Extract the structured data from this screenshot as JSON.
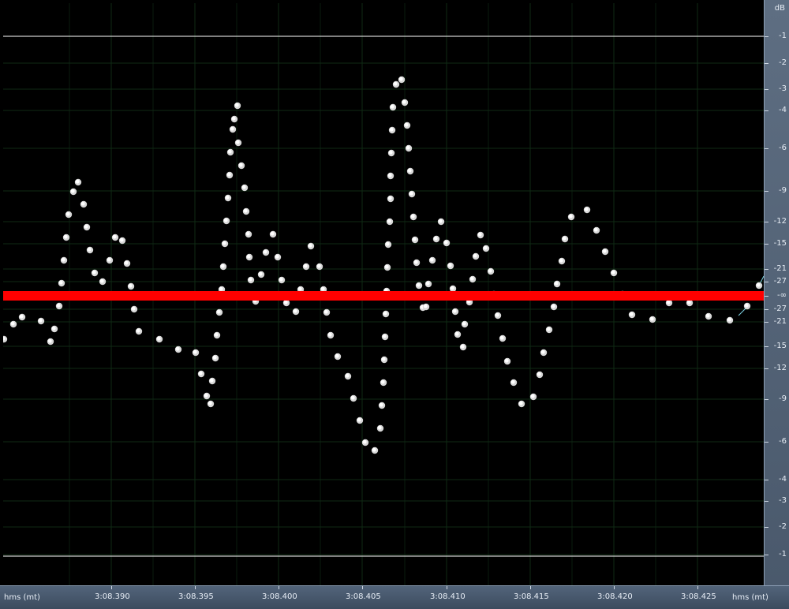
{
  "axes": {
    "db_unit": "dB",
    "time_unit_left": "hms (mt)",
    "time_unit_right": "hms (mt)",
    "db_ticks": [
      "-1",
      "-2",
      "-3",
      "-4",
      "-6",
      "-9",
      "-12",
      "-15",
      "-21",
      "-27",
      "-∞",
      "-27",
      "-21",
      "-15",
      "-12",
      "-9",
      "-6",
      "-4",
      "-3",
      "-2",
      "-1"
    ],
    "db_tick_pos": [
      46,
      80,
      113,
      140,
      188,
      242,
      281,
      309,
      341,
      357,
      375,
      392,
      408,
      439,
      467,
      506,
      560,
      608,
      635,
      668,
      703
    ],
    "time_ticks": [
      "3:08.390",
      "3:08.395",
      "3:08.400",
      "3:08.405",
      "3:08.410",
      "3:08.415",
      "3:08.420",
      "3:08.425"
    ],
    "time_tick_pos": [
      141,
      247,
      353,
      459,
      566,
      672,
      778,
      884
    ]
  },
  "colors": {
    "background": "#000000",
    "sample_dots": "#ffffff",
    "center_line": "#ff0000",
    "clip_lines": "#ffffff",
    "grid": "#0f2a14",
    "axis_panel": "#55667b"
  },
  "chart_data": {
    "type": "scatter",
    "title": "",
    "xlabel": "hms (mt)",
    "ylabel": "dB",
    "samples": [
      [
        5,
        430
      ],
      [
        17,
        411
      ],
      [
        28,
        402
      ],
      [
        52,
        407
      ],
      [
        64,
        433
      ],
      [
        69,
        417
      ],
      [
        75,
        388
      ],
      [
        78,
        359
      ],
      [
        81,
        330
      ],
      [
        84,
        301
      ],
      [
        87,
        272
      ],
      [
        93,
        243
      ],
      [
        99,
        231
      ],
      [
        106,
        259
      ],
      [
        110,
        288
      ],
      [
        114,
        317
      ],
      [
        120,
        346
      ],
      [
        130,
        357
      ],
      [
        139,
        330
      ],
      [
        146,
        301
      ],
      [
        155,
        305
      ],
      [
        161,
        334
      ],
      [
        166,
        363
      ],
      [
        170,
        392
      ],
      [
        176,
        420
      ],
      [
        202,
        430
      ],
      [
        226,
        443
      ],
      [
        248,
        447
      ],
      [
        255,
        474
      ],
      [
        262,
        502
      ],
      [
        267,
        512
      ],
      [
        269,
        483
      ],
      [
        273,
        454
      ],
      [
        275,
        425
      ],
      [
        278,
        396
      ],
      [
        281,
        367
      ],
      [
        283,
        338
      ],
      [
        285,
        309
      ],
      [
        287,
        280
      ],
      [
        289,
        251
      ],
      [
        291,
        222
      ],
      [
        292,
        193
      ],
      [
        295,
        164
      ],
      [
        297,
        151
      ],
      [
        301,
        134
      ],
      [
        302,
        181
      ],
      [
        306,
        210
      ],
      [
        310,
        238
      ],
      [
        312,
        268
      ],
      [
        315,
        297
      ],
      [
        316,
        326
      ],
      [
        318,
        355
      ],
      [
        324,
        382
      ],
      [
        327,
        377
      ],
      [
        331,
        348
      ],
      [
        337,
        320
      ],
      [
        346,
        297
      ],
      [
        352,
        326
      ],
      [
        357,
        355
      ],
      [
        363,
        384
      ],
      [
        375,
        395
      ],
      [
        381,
        367
      ],
      [
        388,
        338
      ],
      [
        394,
        312
      ],
      [
        405,
        338
      ],
      [
        410,
        367
      ],
      [
        414,
        396
      ],
      [
        419,
        425
      ],
      [
        428,
        452
      ],
      [
        441,
        477
      ],
      [
        448,
        505
      ],
      [
        456,
        533
      ],
      [
        463,
        561
      ],
      [
        475,
        571
      ],
      [
        482,
        543
      ],
      [
        484,
        514
      ],
      [
        486,
        485
      ],
      [
        487,
        456
      ],
      [
        488,
        427
      ],
      [
        489,
        398
      ],
      [
        490,
        369
      ],
      [
        491,
        339
      ],
      [
        492,
        310
      ],
      [
        494,
        281
      ],
      [
        495,
        252
      ],
      [
        495,
        223
      ],
      [
        496,
        194
      ],
      [
        497,
        165
      ],
      [
        498,
        136
      ],
      [
        502,
        107
      ],
      [
        509,
        101
      ],
      [
        513,
        130
      ],
      [
        516,
        159
      ],
      [
        518,
        188
      ],
      [
        520,
        217
      ],
      [
        522,
        246
      ],
      [
        524,
        275
      ],
      [
        526,
        304
      ],
      [
        528,
        333
      ],
      [
        531,
        362
      ],
      [
        536,
        390
      ],
      [
        540,
        389
      ],
      [
        543,
        360
      ],
      [
        548,
        330
      ],
      [
        553,
        303
      ],
      [
        559,
        281
      ],
      [
        566,
        308
      ],
      [
        571,
        337
      ],
      [
        574,
        366
      ],
      [
        577,
        395
      ],
      [
        580,
        424
      ],
      [
        587,
        440
      ],
      [
        589,
        411
      ],
      [
        595,
        383
      ],
      [
        599,
        354
      ],
      [
        603,
        325
      ],
      [
        609,
        298
      ],
      [
        616,
        315
      ],
      [
        622,
        344
      ],
      [
        626,
        373
      ],
      [
        631,
        400
      ],
      [
        637,
        429
      ],
      [
        643,
        458
      ],
      [
        651,
        485
      ],
      [
        661,
        512
      ],
      [
        676,
        503
      ],
      [
        684,
        475
      ],
      [
        689,
        447
      ],
      [
        696,
        418
      ],
      [
        702,
        389
      ],
      [
        706,
        360
      ],
      [
        712,
        331
      ],
      [
        716,
        303
      ],
      [
        724,
        275
      ],
      [
        744,
        266
      ],
      [
        756,
        292
      ],
      [
        767,
        319
      ],
      [
        778,
        346
      ],
      [
        789,
        373
      ],
      [
        801,
        399
      ],
      [
        827,
        405
      ],
      [
        848,
        384
      ],
      [
        874,
        384
      ],
      [
        898,
        401
      ],
      [
        925,
        406
      ],
      [
        947,
        388
      ],
      [
        962,
        362
      ]
    ]
  }
}
